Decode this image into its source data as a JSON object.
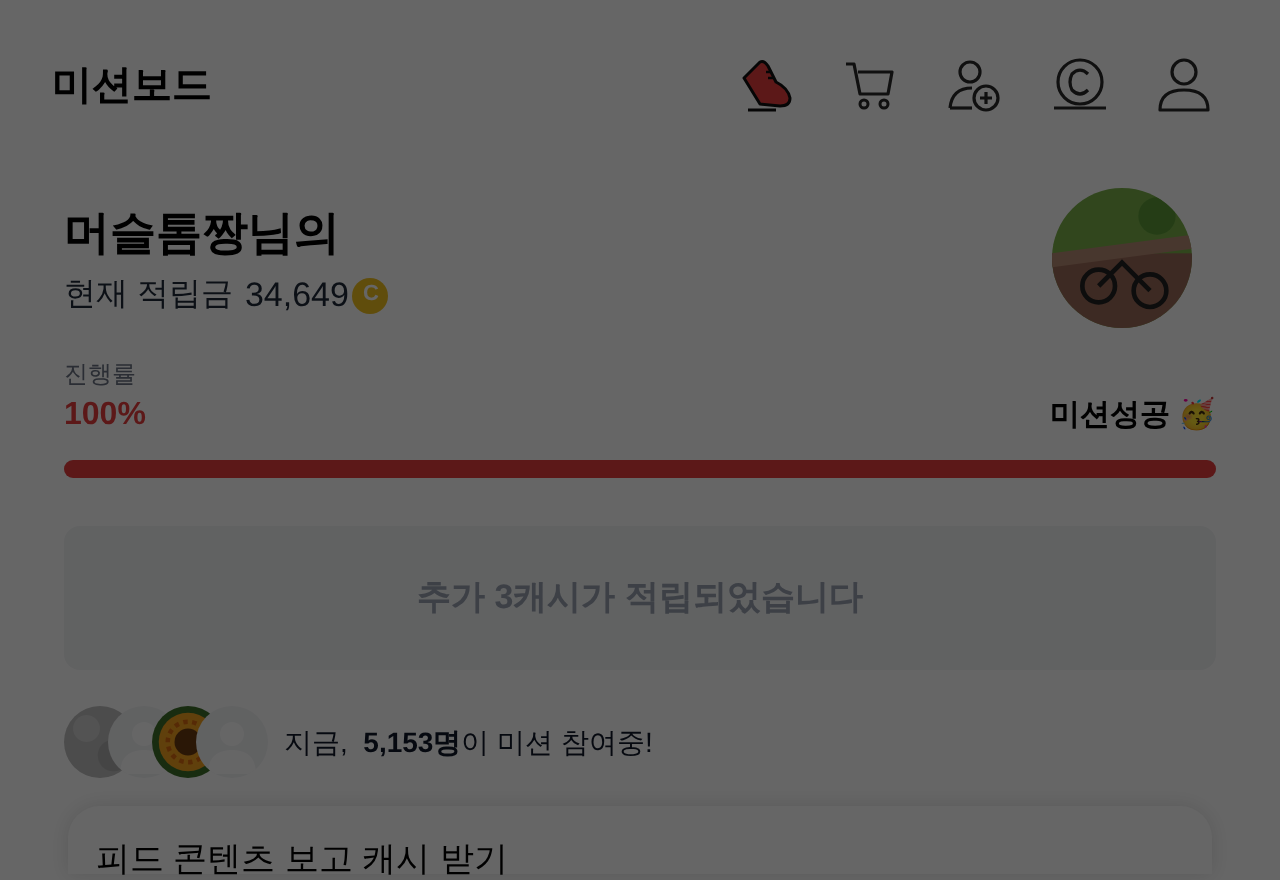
{
  "header": {
    "title": "미션보드",
    "icons": [
      {
        "kind": "shoe",
        "selected": true
      },
      {
        "kind": "cart",
        "selected": false
      },
      {
        "kind": "add-user",
        "selected": false
      },
      {
        "kind": "coin",
        "selected": false
      },
      {
        "kind": "user",
        "selected": false
      }
    ]
  },
  "profile": {
    "name": "머슬톰짱님의",
    "balance_label": "현재 적립금",
    "balance": "34,649",
    "coin": "C",
    "avatar": {
      "kind": "picture"
    }
  },
  "progress": {
    "label": "진행률",
    "percent": "100%",
    "status": "미션성공 🥳",
    "level": 1
  },
  "notice": "추가 3캐시가 적립되었습니다",
  "participants": {
    "avatars": [
      {
        "kind": "picture"
      },
      {
        "kind": "default"
      },
      {
        "kind": "picture"
      },
      {
        "kind": "default"
      }
    ],
    "text": "지금,  **5,153명**이 미션 참여중!"
  },
  "feed_card": {
    "title": "피드 콘텐츠 보고 캐시 받기"
  },
  "overlay": {
    "dimmed": true
  }
}
